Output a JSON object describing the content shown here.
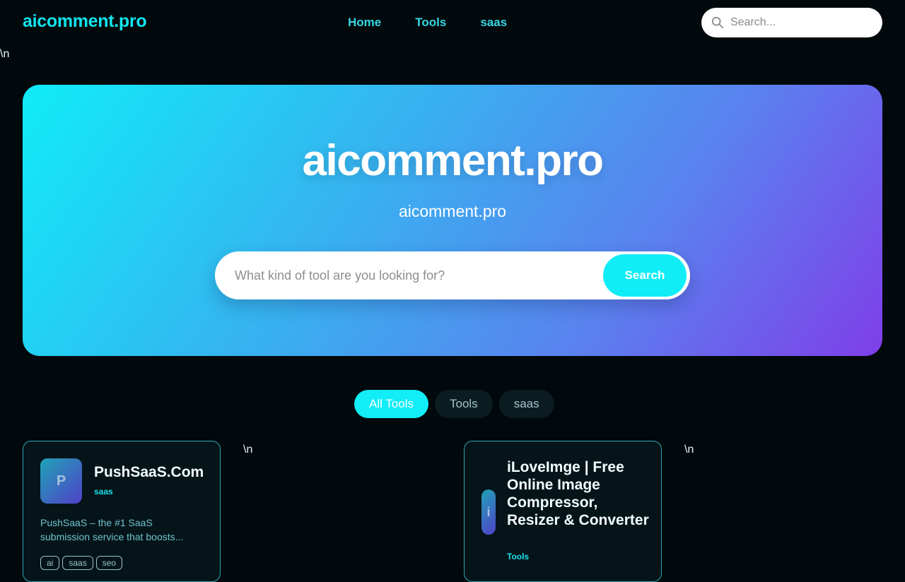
{
  "header": {
    "brand": "aicomment.pro",
    "nav": [
      "Home",
      "Tools",
      "saas"
    ],
    "search_placeholder": "Search..."
  },
  "stray_text": "\\n",
  "hero": {
    "title": "aicomment.pro",
    "subtitle": "aicomment.pro",
    "search_placeholder": "What kind of tool are you looking for?",
    "search_button": "Search"
  },
  "filters": [
    "All Tools",
    "Tools",
    "saas"
  ],
  "active_filter": "All Tools",
  "colors": {
    "accent": "#12e4ef",
    "background": "#02090c",
    "hero_gradient_start": "#10ecf8",
    "hero_gradient_end": "#7f3ee9"
  },
  "cards": [
    {
      "initial": "P",
      "title": "PushSaaS.Com",
      "tag": "saas",
      "description": "PushSaaS – the #1 SaaS submission service that boosts...",
      "pills": [
        "ai",
        "saas",
        "seo"
      ]
    },
    {
      "initial": "i",
      "title": "iLoveImge | Free Online Image Compressor, Resizer & Converter",
      "tag": "Tools"
    }
  ]
}
